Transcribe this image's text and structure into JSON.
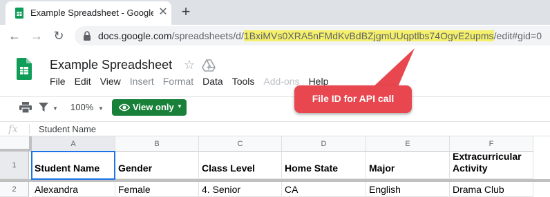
{
  "browser": {
    "tab_title": "Example Spreadsheet - Google S",
    "close_glyph": "✕",
    "new_tab_glyph": "+",
    "url_host": "docs.google.com",
    "url_path_before": "/spreadsheets/d/",
    "url_file_id": "1BxiMVs0XRA5nFMdKvBdBZjgmUUqptlbs74OgvE2upms",
    "url_path_after": "/edit#gid=0",
    "highlight_color": "#f5f06b"
  },
  "header": {
    "doc_title": "Example Spreadsheet",
    "star_glyph": "☆",
    "menu": [
      "File",
      "Edit",
      "View",
      "Insert",
      "Format",
      "Data",
      "Tools",
      "Add-ons",
      "Help"
    ]
  },
  "format_toolbar": {
    "zoom": "100%",
    "view_only_label": "View only",
    "view_only_color": "#188038"
  },
  "formula_bar": {
    "fx_label": "fx",
    "value": "Student Name"
  },
  "grid": {
    "columns": [
      "A",
      "B",
      "C",
      "D",
      "E",
      "F"
    ],
    "rows": [
      {
        "number": "1",
        "cells": [
          "Student Name",
          "Gender",
          "Class Level",
          "Home State",
          "Major",
          "Extracurricular Activity"
        ]
      },
      {
        "number": "2",
        "cells": [
          "Alexandra",
          "Female",
          "4. Senior",
          "CA",
          "English",
          "Drama Club"
        ]
      }
    ]
  },
  "annotation": {
    "text": "File ID for API call",
    "color": "#e8474f"
  }
}
